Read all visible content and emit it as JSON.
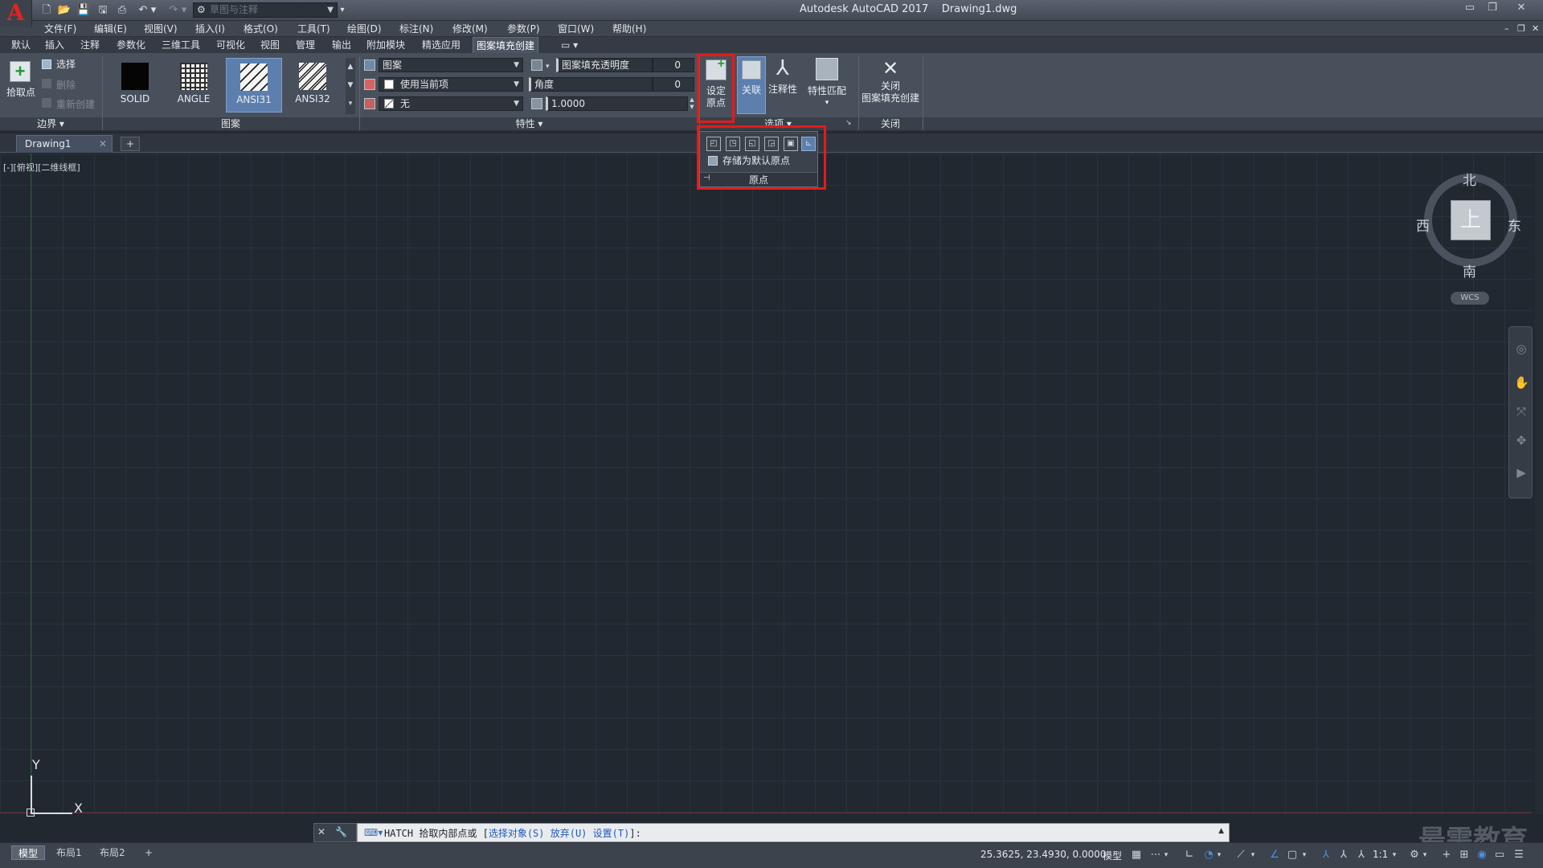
{
  "window": {
    "app_name": "Autodesk AutoCAD 2017",
    "file_name": "Drawing1.dwg",
    "workspace": "草图与注释"
  },
  "menu": [
    "文件(F)",
    "编辑(E)",
    "视图(V)",
    "插入(I)",
    "格式(O)",
    "工具(T)",
    "绘图(D)",
    "标注(N)",
    "修改(M)",
    "参数(P)",
    "窗口(W)",
    "帮助(H)"
  ],
  "ribbon_tabs": [
    "默认",
    "插入",
    "注释",
    "参数化",
    "三维工具",
    "可视化",
    "视图",
    "管理",
    "输出",
    "附加模块",
    "精选应用",
    "图案填充创建"
  ],
  "ribbon": {
    "boundary": {
      "pick_points": "拾取点",
      "select": "选择",
      "remove": "删除",
      "recreate": "重新创建",
      "panel": "边界 ▾"
    },
    "pattern": {
      "items": [
        "SOLID",
        "ANGLE",
        "ANSI31",
        "ANSI32"
      ],
      "selected": "ANSI31",
      "panel": "图案"
    },
    "properties": {
      "type": "图案",
      "color": "使用当前项",
      "background": "无",
      "transparency_label": "图案填充透明度",
      "transparency_value": "0",
      "angle_label": "角度",
      "angle_value": "0",
      "scale": "1.0000",
      "panel": "特性 ▾"
    },
    "options": {
      "set_origin_line1": "设定",
      "set_origin_line2": "原点",
      "associative": "关联",
      "annotative": "注释性",
      "match_properties": "特性匹配",
      "panel": "选项 ▾"
    },
    "close": {
      "line1": "关闭",
      "line2": "图案填充创建",
      "panel": "关闭"
    }
  },
  "origin_popup": {
    "store_default": "存储为默认原点",
    "title": "原点"
  },
  "document_tab": "Drawing1",
  "viewport_label": "[-][俯视][二维线框]",
  "viewcube": {
    "north": "北",
    "south": "南",
    "east": "东",
    "west": "西",
    "top": "上",
    "wcs": "WCS"
  },
  "ucs": {
    "x": "X",
    "y": "Y"
  },
  "command": {
    "prompt": "HATCH 拾取内部点或 [",
    "opt1": "选择对象(S)",
    "opt2": "放弃(U)",
    "opt3": "设置(T)",
    "suffix": "]:"
  },
  "layouts": [
    "模型",
    "布局1",
    "布局2"
  ],
  "status": {
    "coords": "25.3625, 23.4930, 0.0000",
    "model": "模型",
    "scale": "1:1"
  },
  "watermark": "最需教育"
}
